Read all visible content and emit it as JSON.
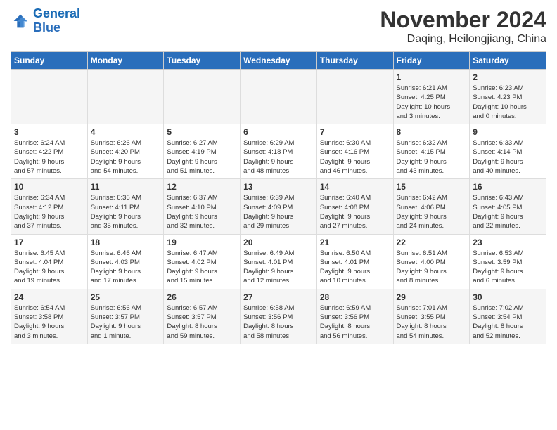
{
  "header": {
    "logo_line1": "General",
    "logo_line2": "Blue",
    "month_title": "November 2024",
    "location": "Daqing, Heilongjiang, China"
  },
  "days_of_week": [
    "Sunday",
    "Monday",
    "Tuesday",
    "Wednesday",
    "Thursday",
    "Friday",
    "Saturday"
  ],
  "weeks": [
    [
      {
        "day": "",
        "info": ""
      },
      {
        "day": "",
        "info": ""
      },
      {
        "day": "",
        "info": ""
      },
      {
        "day": "",
        "info": ""
      },
      {
        "day": "",
        "info": ""
      },
      {
        "day": "1",
        "info": "Sunrise: 6:21 AM\nSunset: 4:25 PM\nDaylight: 10 hours\nand 3 minutes."
      },
      {
        "day": "2",
        "info": "Sunrise: 6:23 AM\nSunset: 4:23 PM\nDaylight: 10 hours\nand 0 minutes."
      }
    ],
    [
      {
        "day": "3",
        "info": "Sunrise: 6:24 AM\nSunset: 4:22 PM\nDaylight: 9 hours\nand 57 minutes."
      },
      {
        "day": "4",
        "info": "Sunrise: 6:26 AM\nSunset: 4:20 PM\nDaylight: 9 hours\nand 54 minutes."
      },
      {
        "day": "5",
        "info": "Sunrise: 6:27 AM\nSunset: 4:19 PM\nDaylight: 9 hours\nand 51 minutes."
      },
      {
        "day": "6",
        "info": "Sunrise: 6:29 AM\nSunset: 4:18 PM\nDaylight: 9 hours\nand 48 minutes."
      },
      {
        "day": "7",
        "info": "Sunrise: 6:30 AM\nSunset: 4:16 PM\nDaylight: 9 hours\nand 46 minutes."
      },
      {
        "day": "8",
        "info": "Sunrise: 6:32 AM\nSunset: 4:15 PM\nDaylight: 9 hours\nand 43 minutes."
      },
      {
        "day": "9",
        "info": "Sunrise: 6:33 AM\nSunset: 4:14 PM\nDaylight: 9 hours\nand 40 minutes."
      }
    ],
    [
      {
        "day": "10",
        "info": "Sunrise: 6:34 AM\nSunset: 4:12 PM\nDaylight: 9 hours\nand 37 minutes."
      },
      {
        "day": "11",
        "info": "Sunrise: 6:36 AM\nSunset: 4:11 PM\nDaylight: 9 hours\nand 35 minutes."
      },
      {
        "day": "12",
        "info": "Sunrise: 6:37 AM\nSunset: 4:10 PM\nDaylight: 9 hours\nand 32 minutes."
      },
      {
        "day": "13",
        "info": "Sunrise: 6:39 AM\nSunset: 4:09 PM\nDaylight: 9 hours\nand 29 minutes."
      },
      {
        "day": "14",
        "info": "Sunrise: 6:40 AM\nSunset: 4:08 PM\nDaylight: 9 hours\nand 27 minutes."
      },
      {
        "day": "15",
        "info": "Sunrise: 6:42 AM\nSunset: 4:06 PM\nDaylight: 9 hours\nand 24 minutes."
      },
      {
        "day": "16",
        "info": "Sunrise: 6:43 AM\nSunset: 4:05 PM\nDaylight: 9 hours\nand 22 minutes."
      }
    ],
    [
      {
        "day": "17",
        "info": "Sunrise: 6:45 AM\nSunset: 4:04 PM\nDaylight: 9 hours\nand 19 minutes."
      },
      {
        "day": "18",
        "info": "Sunrise: 6:46 AM\nSunset: 4:03 PM\nDaylight: 9 hours\nand 17 minutes."
      },
      {
        "day": "19",
        "info": "Sunrise: 6:47 AM\nSunset: 4:02 PM\nDaylight: 9 hours\nand 15 minutes."
      },
      {
        "day": "20",
        "info": "Sunrise: 6:49 AM\nSunset: 4:01 PM\nDaylight: 9 hours\nand 12 minutes."
      },
      {
        "day": "21",
        "info": "Sunrise: 6:50 AM\nSunset: 4:01 PM\nDaylight: 9 hours\nand 10 minutes."
      },
      {
        "day": "22",
        "info": "Sunrise: 6:51 AM\nSunset: 4:00 PM\nDaylight: 9 hours\nand 8 minutes."
      },
      {
        "day": "23",
        "info": "Sunrise: 6:53 AM\nSunset: 3:59 PM\nDaylight: 9 hours\nand 6 minutes."
      }
    ],
    [
      {
        "day": "24",
        "info": "Sunrise: 6:54 AM\nSunset: 3:58 PM\nDaylight: 9 hours\nand 3 minutes."
      },
      {
        "day": "25",
        "info": "Sunrise: 6:56 AM\nSunset: 3:57 PM\nDaylight: 9 hours\nand 1 minute."
      },
      {
        "day": "26",
        "info": "Sunrise: 6:57 AM\nSunset: 3:57 PM\nDaylight: 8 hours\nand 59 minutes."
      },
      {
        "day": "27",
        "info": "Sunrise: 6:58 AM\nSunset: 3:56 PM\nDaylight: 8 hours\nand 58 minutes."
      },
      {
        "day": "28",
        "info": "Sunrise: 6:59 AM\nSunset: 3:56 PM\nDaylight: 8 hours\nand 56 minutes."
      },
      {
        "day": "29",
        "info": "Sunrise: 7:01 AM\nSunset: 3:55 PM\nDaylight: 8 hours\nand 54 minutes."
      },
      {
        "day": "30",
        "info": "Sunrise: 7:02 AM\nSunset: 3:54 PM\nDaylight: 8 hours\nand 52 minutes."
      }
    ]
  ]
}
